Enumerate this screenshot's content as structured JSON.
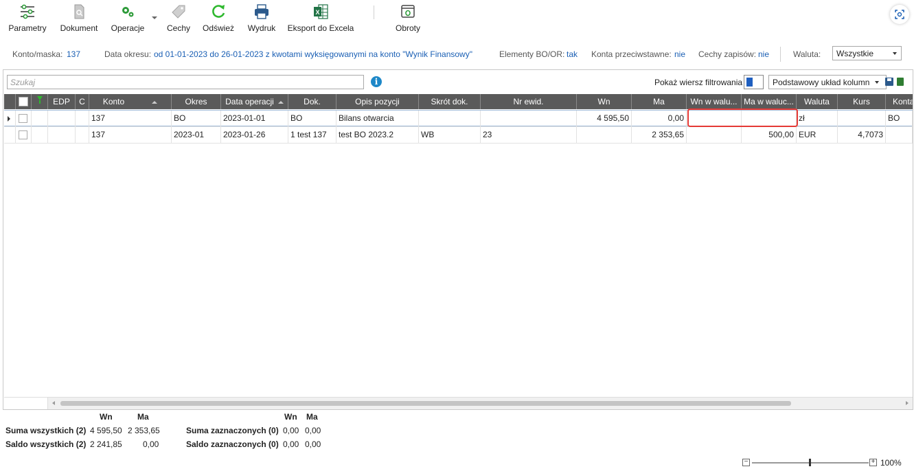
{
  "toolbar": {
    "parametry": "Parametry",
    "dokument": "Dokument",
    "operacje": "Operacje",
    "cechy": "Cechy",
    "odswiez": "Odśwież",
    "wydruk": "Wydruk",
    "eksport": "Eksport do Excela",
    "obroty": "Obroty"
  },
  "info": {
    "konto_label": "Konto/maska:",
    "konto_value": "137",
    "okres_label": "Data okresu:",
    "okres_value": "od 01-01-2023 do 26-01-2023  z kwotami wyksięgowanymi na konto \"Wynik Finansowy\"",
    "bo_label": "Elementy BO/OR:",
    "bo_value": "tak",
    "przeciw_label": "Konta przeciwstawne:",
    "przeciw_value": "nie",
    "cechy_label": "Cechy zapisów:",
    "cechy_value": "nie",
    "waluta_label": "Waluta:",
    "waluta_value": "Wszystkie"
  },
  "grid_toolbar": {
    "search_placeholder": "Szukaj",
    "info_glyph": "i",
    "show_filter_label": "Pokaż wiersz filtrowania",
    "layout_value": "Podstawowy układ kolumn"
  },
  "columns": {
    "edp": "EDP",
    "c": "C",
    "konto": "Konto",
    "okres": "Okres",
    "data": "Data operacji",
    "dok": "Dok.",
    "opis": "Opis pozycji",
    "skrot": "Skrót dok.",
    "nrewid": "Nr ewid.",
    "wn": "Wn",
    "ma": "Ma",
    "wnwal": "Wn w walu...",
    "mawal": "Ma w waluc...",
    "waluta": "Waluta",
    "kurs": "Kurs",
    "konta": "Konta"
  },
  "rows": [
    {
      "konto": "137",
      "okres": "BO",
      "data": "2023-01-01",
      "dok": "BO",
      "opis": "Bilans otwarcia",
      "skrot": "",
      "nrewid": "",
      "wn": "4 595,50",
      "ma": "0,00",
      "wnwal": "",
      "mawal": "",
      "waluta": "zł",
      "kurs": "",
      "konta": "BO"
    },
    {
      "konto": "137",
      "okres": "2023-01",
      "data": "2023-01-26",
      "dok": "1 test 137",
      "opis": "test BO 2023.2",
      "skrot": "WB",
      "nrewid": "23",
      "wn": "",
      "ma": "2 353,65",
      "wnwal": "",
      "mawal": "500,00",
      "waluta": "EUR",
      "kurs": "4,7073",
      "konta": ""
    }
  ],
  "summary": {
    "wn_hdr": "Wn",
    "ma_hdr": "Ma",
    "suma_all_label": "Suma wszystkich (2)",
    "suma_all_wn": "4 595,50",
    "suma_all_ma": "2 353,65",
    "saldo_all_label": "Saldo wszystkich (2)",
    "saldo_all_wn": "2 241,85",
    "saldo_all_ma": "0,00",
    "wn_hdr2": "Wn",
    "ma_hdr2": "Ma",
    "suma_sel_label": "Suma zaznaczonych (0)",
    "suma_sel_wn": "0,00",
    "suma_sel_ma": "0,00",
    "saldo_sel_label": "Saldo zaznaczonych (0)",
    "saldo_sel_wn": "0,00",
    "saldo_sel_ma": "0,00"
  },
  "zoom": {
    "minus": "−",
    "plus": "+",
    "value": "100%"
  }
}
